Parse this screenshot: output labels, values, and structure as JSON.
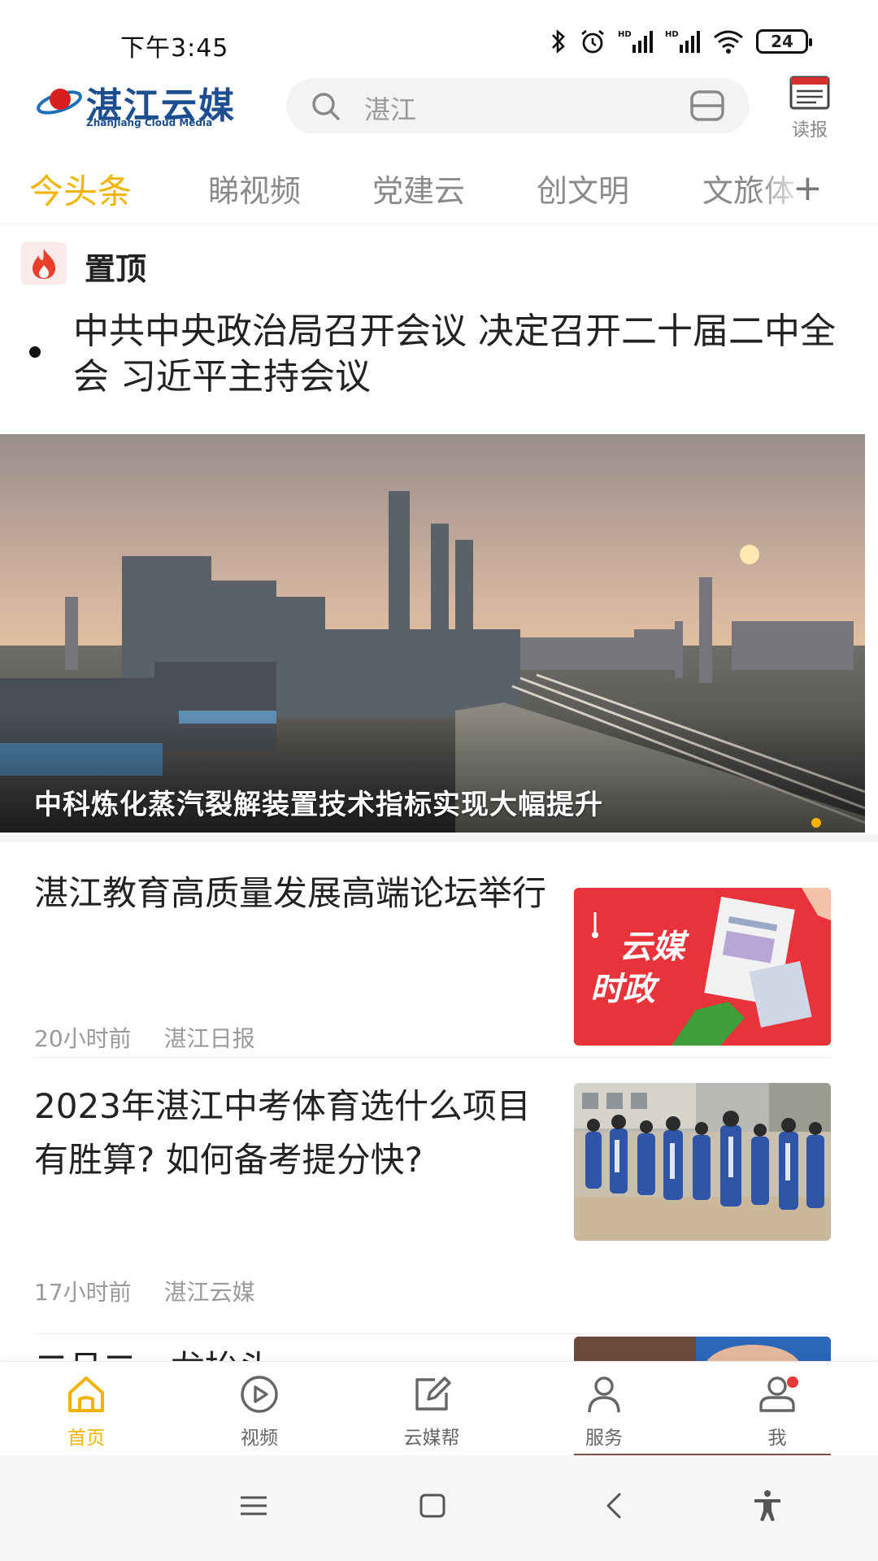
{
  "status_bar": {
    "time": "下午3:45",
    "battery": "24",
    "icons": [
      "bluetooth-icon",
      "alarm-icon",
      "hd-signal-icon",
      "hd-signal-icon",
      "wifi-icon",
      "battery-icon"
    ]
  },
  "header": {
    "logo_text": "湛江云媒",
    "logo_subtitle": "ZhanJiang Cloud Media",
    "search_value": "湛江",
    "reader_label": "读报"
  },
  "tabs": [
    {
      "label": "今头条",
      "active": true
    },
    {
      "label": "睇视频",
      "active": false
    },
    {
      "label": "党建云",
      "active": false
    },
    {
      "label": "创文明",
      "active": false
    },
    {
      "label": "文旅体",
      "active": false
    }
  ],
  "pinned": {
    "label": "置顶",
    "title": "中共中央政治局召开会议 决定召开二十届二中全会 习近平主持会议"
  },
  "banner": {
    "caption": "中科炼化蒸汽裂解装置技术指标实现大幅提升"
  },
  "news": [
    {
      "title": "湛江教育高质量发展高端论坛举行",
      "time": "20小时前",
      "source": "湛江日报",
      "thumb_text_1": "云媒",
      "thumb_text_2": "时政"
    },
    {
      "title": "2023年湛江中考体育选什么项目有胜算? 如何备考提分快?",
      "time": "17小时前",
      "source": "湛江云媒"
    },
    {
      "title": "二月二，龙抬头"
    }
  ],
  "bottom_nav": [
    {
      "label": "首页",
      "icon": "home-icon",
      "active": true
    },
    {
      "label": "视频",
      "icon": "play-icon",
      "active": false
    },
    {
      "label": "云媒帮",
      "icon": "edit-icon",
      "active": false
    },
    {
      "label": "服务",
      "icon": "person-icon",
      "active": false
    },
    {
      "label": "我",
      "icon": "profile-icon",
      "active": false
    }
  ],
  "colors": {
    "accent": "#f2b400",
    "brand": "#1d4e8f",
    "badge": "#e53935"
  }
}
